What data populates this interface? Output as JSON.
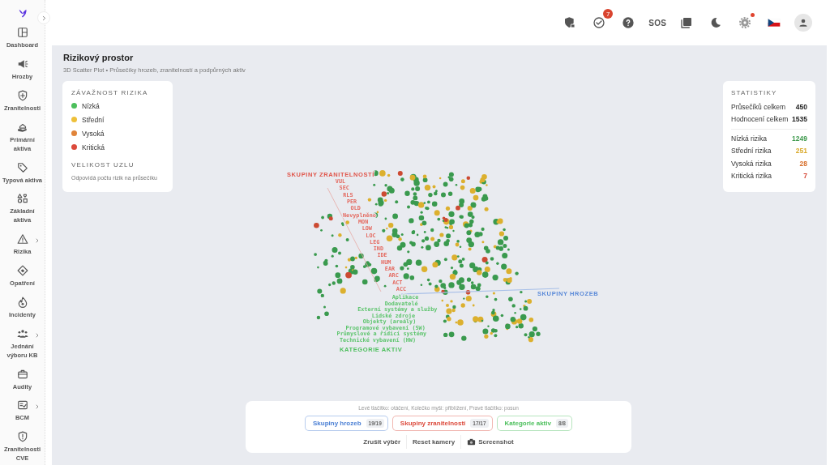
{
  "sidebar": {
    "items": [
      {
        "label": "Dashboard",
        "has_submenu": false
      },
      {
        "label": "Hrozby",
        "has_submenu": false
      },
      {
        "label": "Zranitelnosti",
        "has_submenu": false
      },
      {
        "label": "Primární aktiva",
        "has_submenu": false
      },
      {
        "label": "Typová aktiva",
        "has_submenu": false
      },
      {
        "label": "Základní aktiva",
        "has_submenu": false
      },
      {
        "label": "Rizika",
        "has_submenu": true
      },
      {
        "label": "Opatření",
        "has_submenu": false
      },
      {
        "label": "Incidenty",
        "has_submenu": false
      },
      {
        "label": "Jednání výboru KB",
        "has_submenu": true
      },
      {
        "label": "Audity",
        "has_submenu": false
      },
      {
        "label": "BCM",
        "has_submenu": true
      },
      {
        "label": "Zranitelnosti CVE",
        "has_submenu": false
      }
    ]
  },
  "toolbar": [
    {
      "kind": "shield"
    },
    {
      "kind": "tasks",
      "badge": "7"
    },
    {
      "kind": "help"
    },
    {
      "kind": "sos",
      "label": "SOS"
    },
    {
      "kind": "pdf"
    },
    {
      "kind": "moon"
    },
    {
      "kind": "settings",
      "dot": true
    },
    {
      "kind": "flag"
    },
    {
      "kind": "avatar"
    }
  ],
  "page": {
    "title": "Rizikový prostor",
    "subtitle": "3D Scatter Plot • Průsečíky hrozeb, zranitelností a podpůrných aktiv"
  },
  "legend": {
    "title": "ZÁVAŽNOST RIZIKA",
    "levels": [
      {
        "label": "Nízká",
        "color": "#4cbf5c"
      },
      {
        "label": "Střední",
        "color": "#eec03a"
      },
      {
        "label": "Vysoká",
        "color": "#e0843a"
      },
      {
        "label": "Kritická",
        "color": "#dc4a3c"
      }
    ],
    "size_title": "VELIKOST UZLU",
    "size_note": "Odpovídá počtu rizik na průsečíku"
  },
  "statistics": {
    "title": "STATISTIKY",
    "totals": [
      {
        "label": "Průsečíků celkem",
        "value": "450"
      },
      {
        "label": "Hodnocení celkem",
        "value": "1535"
      }
    ],
    "risks": [
      {
        "label": "Nízká rizika",
        "value": "1249",
        "color": "#3f9a4e"
      },
      {
        "label": "Střední rizika",
        "value": "251",
        "color": "#d9a92a"
      },
      {
        "label": "Vysoká rizika",
        "value": "28",
        "color": "#d8702c"
      },
      {
        "label": "Kritická rizika",
        "value": "7",
        "color": "#d4402f"
      }
    ]
  },
  "scatter": {
    "vulnerability_axis": {
      "title": "SKUPINY ZRANITELNOSTÍ",
      "labels": [
        "VUL",
        "SEC",
        "RLS",
        "PER",
        "OLD",
        "Nevyplněno",
        "MON",
        "LOW",
        "LOC",
        "LEG",
        "IND",
        "IDE",
        "HUM",
        "EAR",
        "ARC",
        "ACT",
        "ACC"
      ]
    },
    "threat_axis": {
      "title": "SKUPINY HROZEB"
    },
    "asset_axis": {
      "title": "KATEGORIE AKTIV",
      "labels": [
        "Aplikace",
        "Dodavatelé",
        "Externí systémy a služby",
        "Lidské zdroje",
        "Objekty (areály)",
        "Programové vybavení (SW)",
        "Průmyslové a řídicí systémy",
        "Technické vybavení (HW)"
      ]
    }
  },
  "controls": {
    "hint": "Levé tlačítko: otáčení, Kolečko myši: přiblížení, Pravé tlačítko: posun",
    "filters": [
      {
        "label": "Skupiny hrozeb",
        "count": "19/19",
        "color": "#4a7fd4",
        "selected": true
      },
      {
        "label": "Skupiny zranitelností",
        "count": "17/17",
        "color": "#dc4a3c",
        "selected": true
      },
      {
        "label": "Kategorie aktiv",
        "count": "8/8",
        "color": "#4cbf5c",
        "selected": true
      }
    ],
    "actions": [
      {
        "label": "Zrušit výběr",
        "kind": "text"
      },
      {
        "label": "Reset kamery",
        "kind": "text"
      },
      {
        "label": "Screenshot",
        "kind": "camera"
      }
    ]
  }
}
